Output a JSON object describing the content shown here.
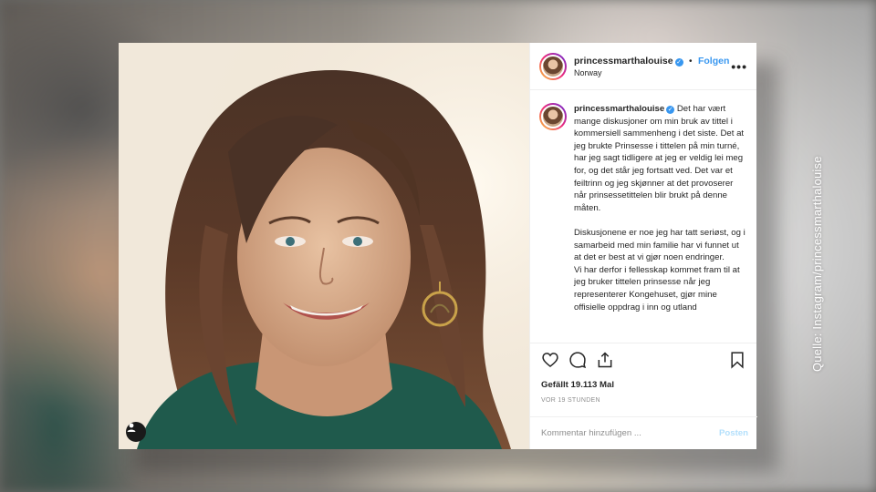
{
  "credit": "Quelle: Instagram/princessmarthalouise",
  "post": {
    "username": "princessmarthalouise",
    "follow_label": "Folgen",
    "separator": "•",
    "location": "Norway",
    "more_label": "•••",
    "caption": {
      "username": "princessmarthalouise",
      "paragraph1": "Det har vært mange diskusjoner om min bruk av tittel i kommersiell sammenheng i det siste. Det at jeg brukte Prinsesse i tittelen på min turné, har jeg sagt tidligere at jeg er veldig lei meg for, og det står jeg fortsatt ved. Det var et feiltrinn og jeg skjønner at det provoserer når prinsessetittelen blir brukt på denne måten.",
      "paragraph2": "Diskusjonene er noe jeg har tatt seriøst, og i samarbeid med min familie har vi funnet ut at det er best at vi gjør noen endringer.",
      "paragraph3": "Vi har derfor i fellesskap kommet fram til at jeg bruker tittelen prinsesse når jeg representerer Kongehuset, gjør mine offisielle oppdrag i inn og utland"
    },
    "likes": "Gefällt 19.113 Mal",
    "timestamp": "VOR 19 STUNDEN",
    "comment_placeholder": "Kommentar hinzufügen ...",
    "post_button": "Posten",
    "icons": [
      "heart-icon",
      "comment-icon",
      "share-icon",
      "bookmark-icon",
      "user-tag-icon",
      "verified-badge-icon"
    ],
    "colors": {
      "accent": "#3897f0",
      "text": "#262626",
      "muted": "#8e8e8e",
      "post_disabled": "#b2dffc"
    }
  }
}
